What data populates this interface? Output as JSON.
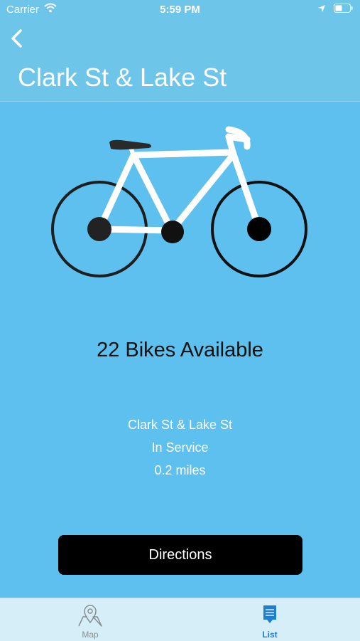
{
  "status_bar": {
    "carrier": "Carrier",
    "time": "5:59 PM"
  },
  "header": {
    "title": "Clark St & Lake St",
    "back_icon": "chevron-left-icon"
  },
  "station": {
    "availability": "22 Bikes Available",
    "name": "Clark St & Lake St",
    "status": "In Service",
    "distance": "0.2 miles"
  },
  "actions": {
    "directions_label": "Directions"
  },
  "tabbar": {
    "tabs": [
      {
        "label": "Map",
        "icon": "map-pin-icon",
        "selected": false
      },
      {
        "label": "List",
        "icon": "list-icon",
        "selected": true
      }
    ]
  },
  "colors": {
    "background": "#5dc0ee",
    "header": "#6ec5ea",
    "button": "#000000",
    "tab_selected": "#1d7fd1"
  }
}
